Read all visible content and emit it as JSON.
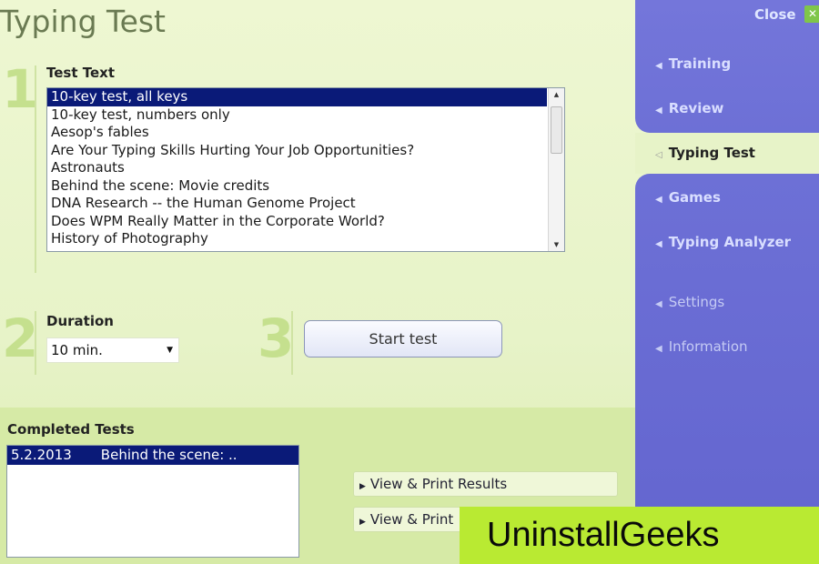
{
  "title": "Typing Test",
  "steps": {
    "one": "1",
    "two": "2",
    "three": "3"
  },
  "test_text": {
    "label": "Test Text",
    "items": [
      "10-key test, all keys",
      "10-key test, numbers only",
      "Aesop's fables",
      "Are Your Typing Skills Hurting Your Job Opportunities?",
      "Astronauts",
      "Behind the scene: Movie credits",
      "DNA Research -- the Human Genome Project",
      "Does WPM Really Matter in the Corporate World?",
      "History of Photography"
    ],
    "selected_index": 0
  },
  "duration": {
    "label": "Duration",
    "value": "10 min."
  },
  "start_button": "Start test",
  "completed_tests": {
    "label": "Completed Tests",
    "rows": [
      {
        "date": "5.2.2013",
        "name": "Behind the scene: .."
      }
    ]
  },
  "actions": {
    "view_print_results": "View & Print Results",
    "view_print_2": "View & Print"
  },
  "sidebar": {
    "close": "Close",
    "items": [
      {
        "label": "Training"
      },
      {
        "label": "Review"
      },
      {
        "label": "Typing Test",
        "active": true
      },
      {
        "label": "Games"
      },
      {
        "label": "Typing Analyzer"
      },
      {
        "label": "Settings"
      },
      {
        "label": "Information"
      }
    ]
  },
  "watermark": "UninstallGeeks",
  "colors": {
    "sidebar": "#6a6cd4",
    "selection": "#0a1a78",
    "background": "#e7f3c8",
    "watermark": "#b9ea32"
  }
}
